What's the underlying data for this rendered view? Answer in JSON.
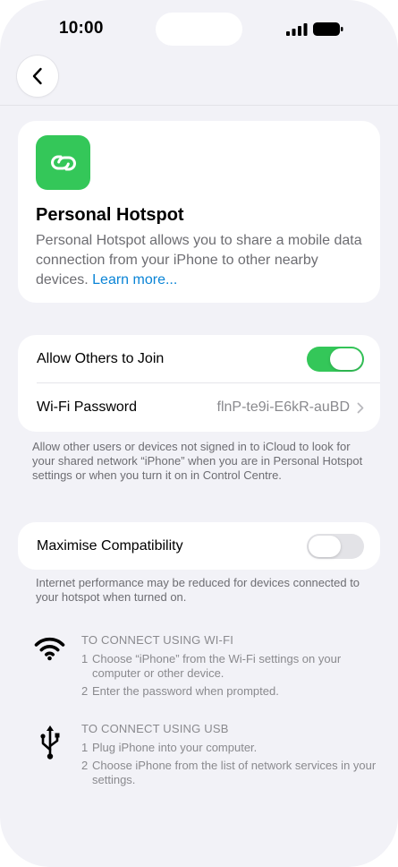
{
  "status_bar": {
    "time": "10:00"
  },
  "colors": {
    "accent_green": "#34c759",
    "link_blue": "#0a84d6",
    "background": "#f2f2f7"
  },
  "intro": {
    "icon": "hotspot-link-icon",
    "title": "Personal Hotspot",
    "description": "Personal Hotspot allows you to share a mobile data connection from your iPhone to other nearby devices.",
    "link": "Learn more..."
  },
  "settings": {
    "allow_others": {
      "label": "Allow Others to Join",
      "on": true
    },
    "wifi_password": {
      "label": "Wi-Fi Password",
      "value": "flnP-te9i-E6kR-auBD"
    },
    "footnote": "Allow other users or devices not signed in to iCloud to look for your shared network “iPhone” when you are in Personal Hotspot settings or when you turn it on in Control Centre."
  },
  "compatibility": {
    "label": "Maximise Compatibility",
    "on": false,
    "footnote": "Internet performance may be reduced for devices connected to your hotspot when turned on."
  },
  "connect_wifi": {
    "icon": "wifi-icon",
    "heading": "TO CONNECT USING WI-FI",
    "steps": [
      {
        "num": "1",
        "text": "Choose “iPhone” from the Wi-Fi settings on your computer or other device."
      },
      {
        "num": "2",
        "text": "Enter the password when prompted."
      }
    ]
  },
  "connect_usb": {
    "icon": "usb-icon",
    "heading": "TO CONNECT USING USB",
    "steps": [
      {
        "num": "1",
        "text": "Plug iPhone into your computer."
      },
      {
        "num": "2",
        "text": "Choose iPhone from the list of network services in your settings."
      }
    ]
  }
}
